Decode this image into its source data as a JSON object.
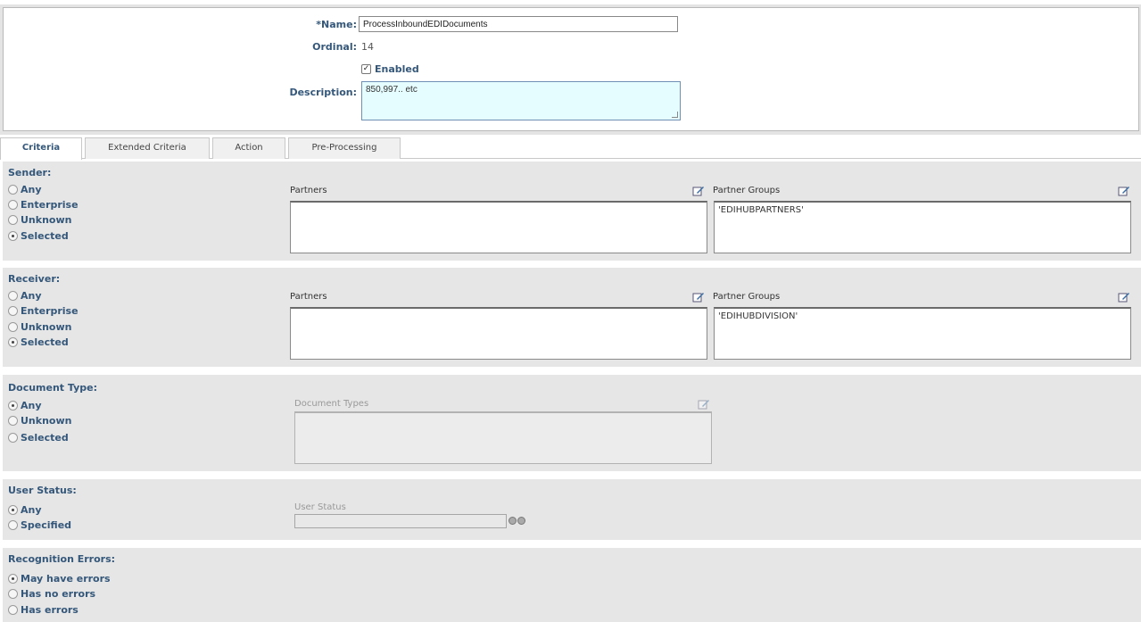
{
  "form": {
    "name_label_req": "*",
    "name_label": "Name:",
    "name_value": "ProcessInboundEDIDocuments",
    "ordinal_label": "Ordinal:",
    "ordinal_value": "14",
    "enabled_label": "Enabled",
    "enabled_checked": true,
    "description_label": "Description:",
    "description_value": "850,997.. etc"
  },
  "tabs": [
    {
      "label": "Criteria",
      "active": true
    },
    {
      "label": "Extended Criteria",
      "active": false
    },
    {
      "label": "Action",
      "active": false
    },
    {
      "label": "Pre-Processing",
      "active": false
    }
  ],
  "sender": {
    "title": "Sender:",
    "options": [
      "Any",
      "Enterprise",
      "Unknown",
      "Selected"
    ],
    "selected": "Selected",
    "partners_label": "Partners",
    "partners_items": [],
    "groups_label": "Partner Groups",
    "groups_items": [
      "'EDIHUBPARTNERS'"
    ]
  },
  "receiver": {
    "title": "Receiver:",
    "options": [
      "Any",
      "Enterprise",
      "Unknown",
      "Selected"
    ],
    "selected": "Selected",
    "partners_label": "Partners",
    "partners_items": [],
    "groups_label": "Partner Groups",
    "groups_items": [
      "'EDIHUBDIVISION'"
    ]
  },
  "document_type": {
    "title": "Document Type:",
    "options": [
      "Any",
      "Unknown",
      "Selected"
    ],
    "selected": "Any",
    "list_label": "Document Types"
  },
  "user_status": {
    "title": "User Status:",
    "options": [
      "Any",
      "Specified"
    ],
    "selected": "Any",
    "field_label": "User Status",
    "field_value": ""
  },
  "recognition_errors": {
    "title": "Recognition Errors:",
    "options": [
      "May have errors",
      "Has no errors",
      "Has errors"
    ],
    "selected": "May have errors"
  },
  "icons": {
    "edit": "edit-icon",
    "add": "add-icon",
    "remove": "remove-icon"
  }
}
